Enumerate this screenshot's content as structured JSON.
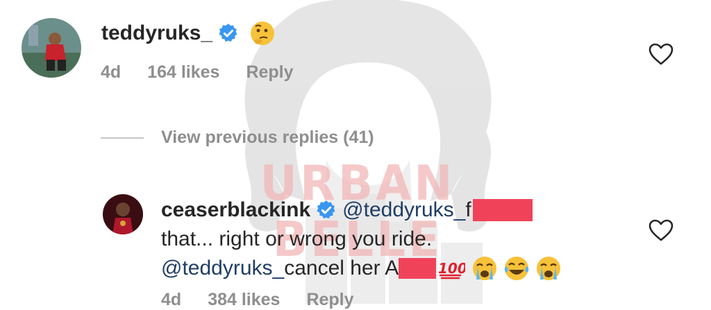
{
  "comment1": {
    "username": "teddyruks_",
    "time": "4d",
    "likes": "164 likes",
    "reply": "Reply"
  },
  "view_replies": "View previous replies (41)",
  "watermark": "URBAN BELLE",
  "comment2": {
    "username": "ceaserblackink",
    "mention1": "@teddyruks_",
    "text1_tail": " f",
    "text2": "that... right or wrong you ride.",
    "mention2": "@teddyruks_",
    "text3": " cancel her A",
    "time": "4d",
    "likes": "384 likes",
    "reply": "Reply"
  },
  "colors": {
    "verified": "#3897f0",
    "redaction": "#f0435a",
    "mention": "#1f3d66",
    "meta": "#8e8e8e"
  },
  "icons": [
    "verified-badge-icon",
    "thinking-face-emoji",
    "heart-icon",
    "hundred-points-emoji",
    "crying-face-emoji",
    "tears-of-joy-emoji"
  ]
}
